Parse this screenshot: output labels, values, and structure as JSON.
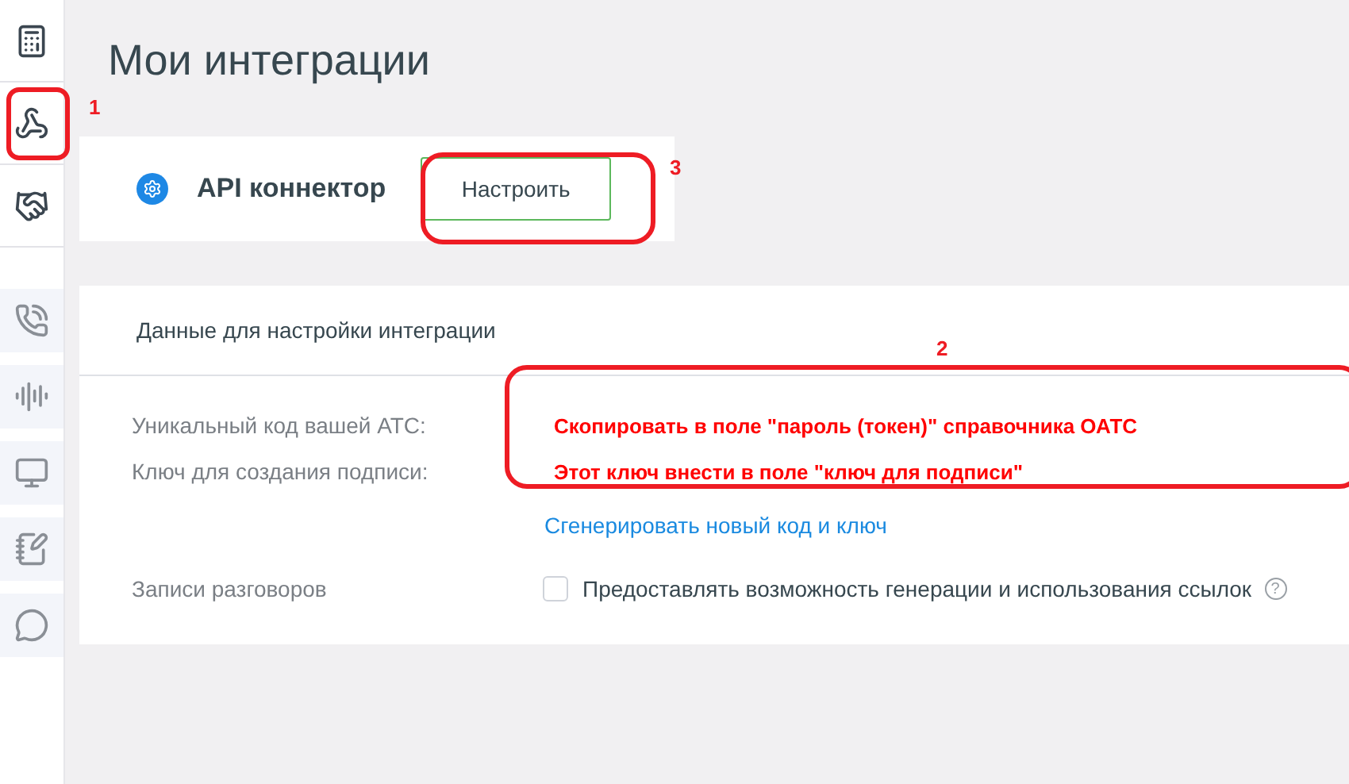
{
  "page_title": "Мои интеграции",
  "integration": {
    "name": "API коннектор",
    "button": "Настроить"
  },
  "settings": {
    "header": "Данные для настройки интеграции",
    "rows": [
      {
        "label": "Уникальный код вашей АТС:",
        "note": "Скопировать в поле \"пароль (токен)\" справочника ОАТС"
      },
      {
        "label": "Ключ для создания подписи:",
        "note": "Этот ключ внести в поле \"ключ для подписи\""
      }
    ],
    "link": "Сгенерировать новый код и ключ",
    "recordings": {
      "label": "Записи разговоров",
      "checkbox": "Предоставлять возможность генерации и использования ссылок",
      "checked": false,
      "help": "?"
    }
  },
  "annotations": [
    {
      "label": "1"
    },
    {
      "label": "3"
    },
    {
      "label": "2"
    }
  ]
}
